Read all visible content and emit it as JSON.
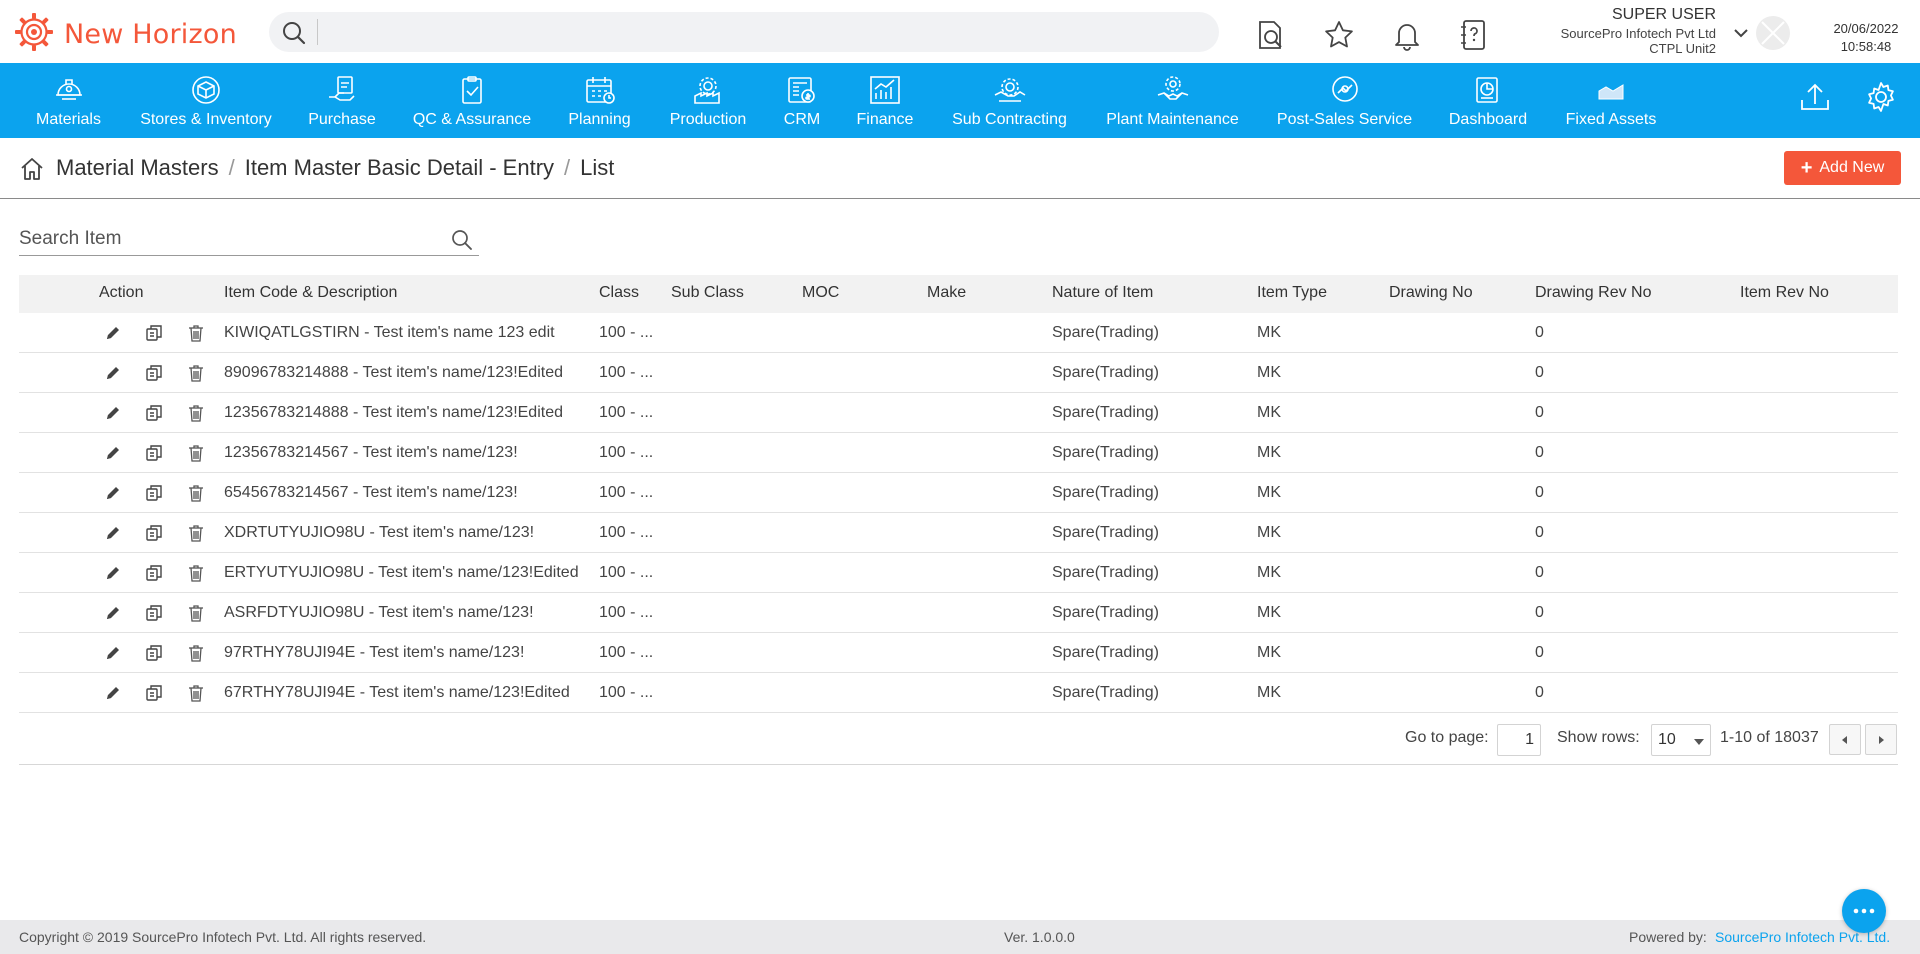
{
  "app": {
    "name": "New Horizon",
    "brand_color": "#f4573a",
    "nav_color": "#0ba3ee"
  },
  "header": {
    "search_placeholder": "",
    "icons": [
      "document-search-icon",
      "star-icon",
      "bell-icon",
      "help-book-icon"
    ],
    "user": {
      "name": "SUPER USER",
      "company": "SourcePro Infotech Pvt Ltd",
      "unit": "CTPL Unit2"
    },
    "date": "20/06/2022",
    "time": "10:58:48"
  },
  "modules": [
    {
      "label": "Materials",
      "icon": "helmet-icon"
    },
    {
      "label": "Stores & Inventory",
      "icon": "cube-icon"
    },
    {
      "label": "Purchase",
      "icon": "purchase-icon"
    },
    {
      "label": "QC & Assurance",
      "icon": "clipboard-check-icon"
    },
    {
      "label": "Planning",
      "icon": "calendar-icon"
    },
    {
      "label": "Production",
      "icon": "factory-gear-icon"
    },
    {
      "label": "CRM",
      "icon": "crm-icon"
    },
    {
      "label": "Finance",
      "icon": "bar-chart-icon"
    },
    {
      "label": "Sub Contracting",
      "icon": "contract-gear-icon"
    },
    {
      "label": "Plant Maintenance",
      "icon": "handshake-icon"
    },
    {
      "label": "Post-Sales Service",
      "icon": "service-hand-icon"
    },
    {
      "label": "Dashboard",
      "icon": "dashboard-icon"
    },
    {
      "label": "Fixed Assets",
      "icon": "area-chart-icon"
    }
  ],
  "breadcrumb": {
    "items": [
      "Material Masters",
      "Item Master Basic Detail - Entry",
      "List"
    ],
    "separator": "/"
  },
  "actions": {
    "add_new": "Add New"
  },
  "search": {
    "placeholder": "Search Item"
  },
  "table": {
    "columns": [
      "Action",
      "Item Code & Description",
      "Class",
      "Sub Class",
      "MOC",
      "Make",
      "Nature of Item",
      "Item Type",
      "Drawing No",
      "Drawing Rev No",
      "Item Rev No"
    ],
    "rows": [
      {
        "item": "KIWIQATLGSTIRN - Test item's name 123 edit",
        "class": "100 - ...",
        "sub_class": "",
        "moc": "",
        "make": "",
        "nature": "Spare(Trading)",
        "type": "MK",
        "drawing_no": "",
        "drawing_rev": "0",
        "item_rev": ""
      },
      {
        "item": "89096783214888 - Test item's name/123!Edited",
        "class": "100 - ...",
        "sub_class": "",
        "moc": "",
        "make": "",
        "nature": "Spare(Trading)",
        "type": "MK",
        "drawing_no": "",
        "drawing_rev": "0",
        "item_rev": ""
      },
      {
        "item": "12356783214888 - Test item's name/123!Edited",
        "class": "100 - ...",
        "sub_class": "",
        "moc": "",
        "make": "",
        "nature": "Spare(Trading)",
        "type": "MK",
        "drawing_no": "",
        "drawing_rev": "0",
        "item_rev": ""
      },
      {
        "item": "12356783214567 - Test item's name/123!",
        "class": "100 - ...",
        "sub_class": "",
        "moc": "",
        "make": "",
        "nature": "Spare(Trading)",
        "type": "MK",
        "drawing_no": "",
        "drawing_rev": "0",
        "item_rev": ""
      },
      {
        "item": "65456783214567 - Test item's name/123!",
        "class": "100 - ...",
        "sub_class": "",
        "moc": "",
        "make": "",
        "nature": "Spare(Trading)",
        "type": "MK",
        "drawing_no": "",
        "drawing_rev": "0",
        "item_rev": ""
      },
      {
        "item": "XDRTUTYUJIO98U - Test item's name/123!",
        "class": "100 - ...",
        "sub_class": "",
        "moc": "",
        "make": "",
        "nature": "Spare(Trading)",
        "type": "MK",
        "drawing_no": "",
        "drawing_rev": "0",
        "item_rev": ""
      },
      {
        "item": "ERTYUTYUJIO98U - Test item's name/123!Edited",
        "class": "100 - ...",
        "sub_class": "",
        "moc": "",
        "make": "",
        "nature": "Spare(Trading)",
        "type": "MK",
        "drawing_no": "",
        "drawing_rev": "0",
        "item_rev": ""
      },
      {
        "item": "ASRFDTYUJIO98U - Test item's name/123!",
        "class": "100 - ...",
        "sub_class": "",
        "moc": "",
        "make": "",
        "nature": "Spare(Trading)",
        "type": "MK",
        "drawing_no": "",
        "drawing_rev": "0",
        "item_rev": ""
      },
      {
        "item": "97RTHY78UJI94E - Test item's name/123!",
        "class": "100 - ...",
        "sub_class": "",
        "moc": "",
        "make": "",
        "nature": "Spare(Trading)",
        "type": "MK",
        "drawing_no": "",
        "drawing_rev": "0",
        "item_rev": ""
      },
      {
        "item": "67RTHY78UJI94E - Test item's name/123!Edited",
        "class": "100 - ...",
        "sub_class": "",
        "moc": "",
        "make": "",
        "nature": "Spare(Trading)",
        "type": "MK",
        "drawing_no": "",
        "drawing_rev": "0",
        "item_rev": ""
      }
    ]
  },
  "pagination": {
    "goto_label": "Go to page:",
    "current_page": "1",
    "rows_label": "Show rows:",
    "rows_value": "10",
    "range": "1-10 of 18037"
  },
  "footer": {
    "copyright": "Copyright © 2019 SourcePro Infotech Pvt. Ltd. All rights reserved.",
    "version": "Ver. 1.0.0.0",
    "powered_label": "Powered by:",
    "powered_link": "SourcePro Infotech Pvt. Ltd."
  }
}
